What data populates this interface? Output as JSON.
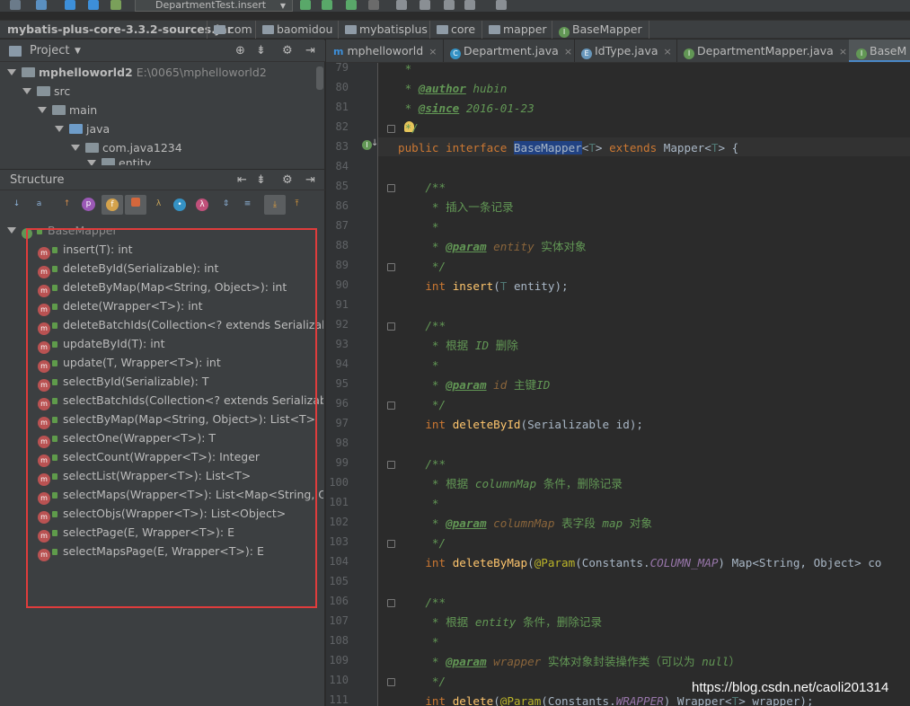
{
  "toolbar": {
    "run_config": "DepartmentTest.insert"
  },
  "breadcrumb": [
    "mybatis-plus-core-3.3.2-sources.jar",
    "com",
    "baomidou",
    "mybatisplus",
    "core",
    "mapper",
    "BaseMapper"
  ],
  "project_panel": {
    "title": "Project",
    "tree": [
      {
        "label": "mphelloworld2",
        "path": "E:\\0065\\mphelloworld2"
      },
      {
        "label": "src"
      },
      {
        "label": "main"
      },
      {
        "label": "java"
      },
      {
        "label": "com.java1234"
      },
      {
        "label": "entity"
      }
    ]
  },
  "structure_panel": {
    "title": "Structure",
    "root": "BaseMapper",
    "methods": [
      "insert(T): int",
      "deleteById(Serializable): int",
      "deleteByMap(Map<String, Object>): int",
      "delete(Wrapper<T>): int",
      "deleteBatchIds(Collection<? extends Serializable>",
      "updateById(T): int",
      "update(T, Wrapper<T>): int",
      "selectById(Serializable): T",
      "selectBatchIds(Collection<? extends Serializable>",
      "selectByMap(Map<String, Object>): List<T>",
      "selectOne(Wrapper<T>): T",
      "selectCount(Wrapper<T>): Integer",
      "selectList(Wrapper<T>): List<T>",
      "selectMaps(Wrapper<T>): List<Map<String, Obj",
      "selectObjs(Wrapper<T>): List<Object>",
      "selectPage(E, Wrapper<T>): E",
      "selectMapsPage(E, Wrapper<T>): E"
    ]
  },
  "editor_tabs": [
    "mphelloworld",
    "Department.java",
    "IdType.java",
    "DepartmentMapper.java",
    "BaseM"
  ],
  "editor": {
    "line_numbers": [
      "79",
      "80",
      "81",
      "82",
      "83",
      "84",
      "85",
      "86",
      "87",
      "88",
      "89",
      "90",
      "91",
      "92",
      "93",
      "94",
      "95",
      "96",
      "97",
      "98",
      "99",
      "100",
      "101",
      "102",
      "103",
      "104",
      "105",
      "106",
      "107",
      "108",
      "109",
      "110",
      "111"
    ],
    "lines": {
      "l79": " *",
      "author_tag": "@author",
      "author_val": "hubin",
      "since_tag": "@since",
      "since_val": "2016-01-23",
      "l83_kw": "public interface ",
      "l83_name": "BaseMapper",
      "l83_t1": "T",
      "l83_ext": " extends ",
      "l83_mapper": "Mapper<",
      "l83_t2": "T",
      "l83_end": "> {",
      "doc_open": "/**",
      "doc_star": "*",
      "doc_close": "*/",
      "insert_desc": "插入一条记录",
      "param_tag": "@param",
      "insert_pname": "entity",
      "insert_pdesc": "实体对象",
      "insert_sig_int": "int ",
      "insert_sig_fn": "insert",
      "insert_sig_t": "T",
      "insert_sig_rest": " entity);",
      "del_desc_a": "根据 ",
      "del_desc_id": "ID",
      "del_desc_b": " 删除",
      "del_pname": "id",
      "del_pdesc_a": "主键",
      "del_pdesc_id": "ID",
      "delid_fn": "deleteById",
      "delid_rest": "(Serializable id);",
      "dmap_desc_a": "根据 ",
      "dmap_desc_cm": "columnMap",
      "dmap_desc_b": " 条件，删除记录",
      "dmap_pname": "columnMap",
      "dmap_pdesc_a": "表字段 ",
      "dmap_pdesc_map": "map",
      "dmap_pdesc_b": " 对象",
      "dmap_fn": "deleteByMap",
      "dmap_ann": "@Param",
      "dmap_c1": "(Constants.",
      "dmap_const": "COLUMN_MAP",
      "dmap_rest": ") Map<String, Object> co",
      "del_desc2_a": "根据 ",
      "del_desc2_e": "entity",
      "del_desc2_b": " 条件，删除记录",
      "del_pname2": "wrapper",
      "del_pdesc2_a": "实体对象封装操作类（可以为 ",
      "del_pdesc2_null": "null",
      "del_pdesc2_b": "）",
      "delete_fn": "delete",
      "delete_ann": "@Param",
      "delete_c1": "(Constants.",
      "delete_const": "WRAPPER",
      "delete_c2": ") Wrapper<",
      "delete_t": "T",
      "delete_rest": "> wrapper);"
    }
  },
  "watermark": "https://blog.csdn.net/caoli201314"
}
